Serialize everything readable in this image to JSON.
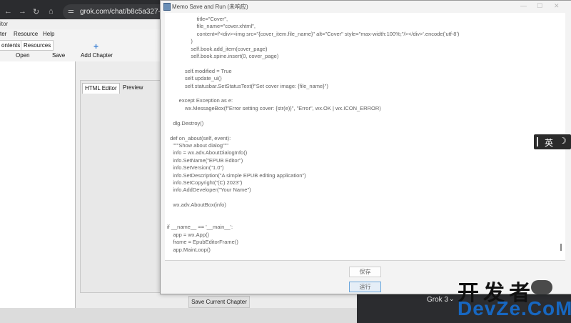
{
  "browser": {
    "url": "grok.com/chat/b8c5a327-7",
    "nav": {
      "back": "←",
      "forward": "→",
      "reload": "↻",
      "home": "⌂",
      "tune": "⚌"
    }
  },
  "epub_editor": {
    "title_partial": "itor",
    "menu": [
      "ter",
      "Resource",
      "Help"
    ],
    "tabs": [
      "ontents",
      "Resources"
    ],
    "toolbar": {
      "open": "Open",
      "save": "Save",
      "add_chapter": "Add Chapter"
    },
    "editor_tabs": [
      "HTML Editor",
      "Preview"
    ],
    "save_chapter": "Save Current Chapter"
  },
  "memo": {
    "title": "Memo Save and Run (未响应)",
    "code_lines": [
      "                    title=\"Cover\",",
      "                    file_name=\"cover.xhtml\",",
      "                    content=f'<div><img src=\"{cover_item.file_name}\" alt=\"Cover\" style=\"max-width:100%;\"/></div>'.encode('utf-8')",
      "                )",
      "                self.book.add_item(cover_page)",
      "                self.book.spine.insert(0, cover_page)",
      "",
      "            self.modified = True",
      "            self.update_ui()",
      "            self.statusbar.SetStatusText(f\"Set cover image: {file_name}\")",
      "",
      "        except Exception as e:",
      "            wx.MessageBox(f\"Error setting cover: {str(e)}\", \"Error\", wx.OK | wx.ICON_ERROR)",
      "",
      "    dlg.Destroy()",
      "",
      "  def on_about(self, event):",
      "    \"\"\"Show about dialog\"\"\"",
      "    info = wx.adv.AboutDialogInfo()",
      "    info.SetName(\"EPUB Editor\")",
      "    info.SetVersion(\"1.0\")",
      "    info.SetDescription(\"A simple EPUB editing application\")",
      "    info.SetCopyright(\"(C) 2023\")",
      "    info.AddDeveloper(\"Your Name\")",
      "",
      "    wx.adv.AboutBox(info)",
      "",
      "",
      "if __name__ == '__main__':",
      "    app = wx.App()",
      "    frame = EpubEditorFrame()",
      "    app.MainLoop()"
    ],
    "buttons": {
      "save": "保存",
      "run": "运行"
    },
    "window_controls": {
      "minimize": "—",
      "maximize": "☐",
      "close": "✕"
    }
  },
  "ime": {
    "lang": "英",
    "mode_icon": "☽"
  },
  "grok": {
    "model": "Grok 3",
    "chevron": "⌄"
  },
  "watermark": {
    "cn": "开发者",
    "en": "DevZe.CoM"
  }
}
